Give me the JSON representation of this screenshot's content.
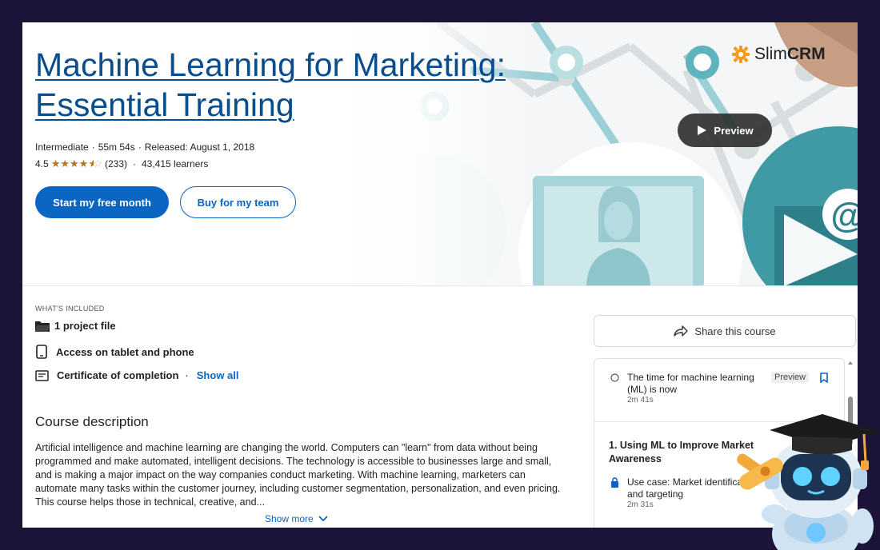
{
  "course": {
    "title": "Machine Learning for Marketing: Essential Training",
    "level": "Intermediate",
    "duration": "55m 54s",
    "released": "Released: August 1, 2018",
    "rating": "4.5",
    "rating_stars": 4.5,
    "reviews": "(233)",
    "learners": "43,415 learners"
  },
  "actions": {
    "start_label": "Start my free month",
    "team_label": "Buy for my team",
    "preview_label": "Preview"
  },
  "brand": {
    "logo_light": "Slim",
    "logo_bold": "CRM",
    "accent": "#0a66c2",
    "logo_gear_color": "#f39c1f"
  },
  "included": {
    "heading": "WHAT'S INCLUDED",
    "items": [
      {
        "label": "1 project file",
        "icon": "folder-icon"
      },
      {
        "label": "Access on tablet and phone",
        "icon": "tablet-icon"
      },
      {
        "label": "Certificate of completion",
        "icon": "certificate-icon"
      }
    ],
    "show_all": "Show all"
  },
  "description": {
    "heading": "Course description",
    "text": "Artificial intelligence and machine learning are changing the world. Computers can \"learn\" from data without being programmed and make automated, intelligent decisions. The technology is accessible to businesses large and small, and is making a major impact on the way companies conduct marketing. With machine learning, marketers can automate many tasks within the customer journey, including customer segmentation, personalization, and even pricing. This course helps those in technical, creative, and...",
    "show_more": "Show more"
  },
  "sidebar": {
    "share_label": "Share this course",
    "toc": {
      "intro_item": {
        "title": "The time for machine learning (ML) is now",
        "duration": "2m 41s",
        "badge": "Preview"
      },
      "chapter_title": "1. Using ML to Improve Market Awareness",
      "chapter_item": {
        "title": "Use case: Market identification and targeting",
        "duration": "2m 31s"
      }
    }
  }
}
